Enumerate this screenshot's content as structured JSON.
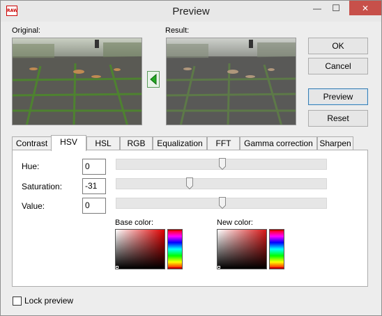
{
  "window": {
    "title": "Preview",
    "app_icon_text": "RAW",
    "controls": {
      "minimize": "—",
      "maximize": "☐",
      "close": "✕"
    }
  },
  "images": {
    "original_label": "Original:",
    "result_label": "Result:"
  },
  "buttons": {
    "ok": "OK",
    "cancel": "Cancel",
    "preview": "Preview",
    "reset": "Reset"
  },
  "tabs": [
    {
      "label": "Contrast",
      "active": false
    },
    {
      "label": "HSV",
      "active": true
    },
    {
      "label": "HSL",
      "active": false
    },
    {
      "label": "RGB",
      "active": false
    },
    {
      "label": "Equalization",
      "active": false
    },
    {
      "label": "FFT",
      "active": false
    },
    {
      "label": "Gamma correction",
      "active": false
    },
    {
      "label": "Sharpen",
      "active": false
    }
  ],
  "hsv": {
    "hue": {
      "label": "Hue:",
      "value": "0"
    },
    "saturation": {
      "label": "Saturation:",
      "value": "-31"
    },
    "value": {
      "label": "Value:",
      "value": "0"
    }
  },
  "colors": {
    "base_label": "Base color:",
    "new_label": "New color:"
  },
  "lock_preview": {
    "label": "Lock preview",
    "checked": false
  }
}
